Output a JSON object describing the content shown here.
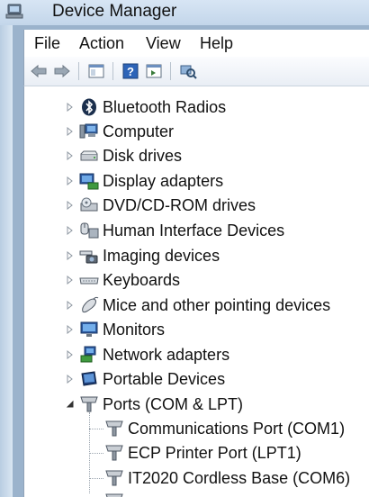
{
  "window": {
    "title": "Device Manager"
  },
  "menu": [
    "File",
    "Action",
    "View",
    "Help"
  ],
  "toolbar": [
    {
      "name": "back-icon"
    },
    {
      "name": "forward-icon"
    },
    {
      "name": "show-hide-console-tree-icon"
    },
    {
      "name": "help-icon"
    },
    {
      "name": "action-pane-icon"
    },
    {
      "name": "scan-hardware-icon"
    }
  ],
  "tree": {
    "categories": [
      {
        "label": "Bluetooth Radios",
        "icon": "bluetooth-icon",
        "expanded": false
      },
      {
        "label": "Computer",
        "icon": "computer-icon",
        "expanded": false
      },
      {
        "label": "Disk drives",
        "icon": "disk-drive-icon",
        "expanded": false
      },
      {
        "label": "Display adapters",
        "icon": "display-adapter-icon",
        "expanded": false
      },
      {
        "label": "DVD/CD-ROM drives",
        "icon": "dvd-drive-icon",
        "expanded": false
      },
      {
        "label": "Human Interface Devices",
        "icon": "hid-icon",
        "expanded": false
      },
      {
        "label": "Imaging devices",
        "icon": "imaging-device-icon",
        "expanded": false
      },
      {
        "label": "Keyboards",
        "icon": "keyboard-icon",
        "expanded": false
      },
      {
        "label": "Mice and other pointing devices",
        "icon": "mouse-icon",
        "expanded": false
      },
      {
        "label": "Monitors",
        "icon": "monitor-icon",
        "expanded": false
      },
      {
        "label": "Network adapters",
        "icon": "network-adapter-icon",
        "expanded": false
      },
      {
        "label": "Portable Devices",
        "icon": "portable-device-icon",
        "expanded": false
      },
      {
        "label": "Ports (COM & LPT)",
        "icon": "port-icon",
        "expanded": true
      }
    ],
    "ports_children": [
      {
        "label": "Communications Port (COM1)",
        "icon": "port-icon"
      },
      {
        "label": "ECP Printer Port (LPT1)",
        "icon": "port-icon"
      },
      {
        "label": "IT2020 Cordless Base (COM6)",
        "icon": "port-icon"
      }
    ]
  },
  "colors": {
    "titlebar": "#c8daee",
    "accent": "#1c5fb4"
  }
}
